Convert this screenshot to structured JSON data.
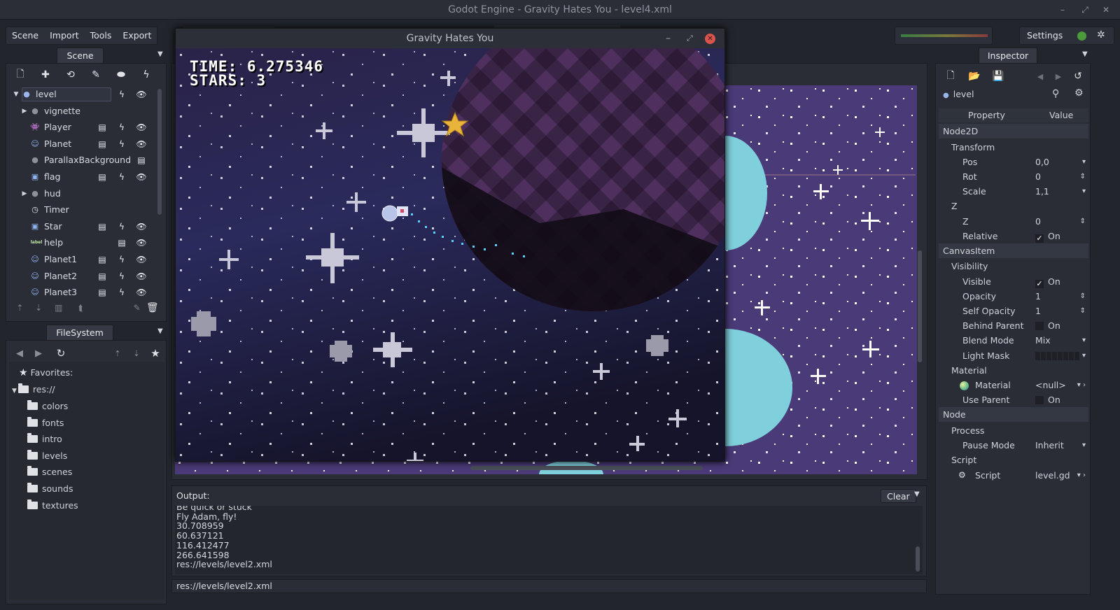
{
  "window": {
    "title": "Godot Engine - Gravity Hates You - level4.xml"
  },
  "menu": [
    "Scene",
    "Import",
    "Tools",
    "Export"
  ],
  "top_right": {
    "settings": "Settings"
  },
  "scene_panel": {
    "tab": "Scene",
    "nodes": [
      {
        "label": "level",
        "icon": "node2d-icon",
        "icon_char": "●",
        "icon_color": "#9ab6e8",
        "arrow": "▼",
        "depth": 0,
        "selected": true,
        "buttons": [
          "script-icon",
          "visibility-icon"
        ]
      },
      {
        "label": "vignette",
        "icon": "node-icon",
        "icon_char": "●",
        "icon_color": "#8d9099",
        "arrow": "▶",
        "depth": 1,
        "buttons": []
      },
      {
        "label": "Player",
        "icon": "kinematic-body-icon",
        "icon_char": "👾",
        "icon_color": "#8fb3f0",
        "arrow": "",
        "depth": 1,
        "buttons": [
          "open-scene-icon",
          "script-icon",
          "visibility-icon"
        ]
      },
      {
        "label": "Planet",
        "icon": "rigid-body-icon",
        "icon_char": "☺",
        "icon_color": "#8fb3f0",
        "arrow": "",
        "depth": 1,
        "buttons": [
          "open-scene-icon",
          "script-icon",
          "visibility-icon"
        ]
      },
      {
        "label": "ParallaxBackground",
        "icon": "node-icon",
        "icon_char": "●",
        "icon_color": "#8d9099",
        "arrow": "",
        "depth": 1,
        "buttons": [
          "open-scene-icon"
        ]
      },
      {
        "label": "flag",
        "icon": "area-icon",
        "icon_char": "▣",
        "icon_color": "#8fb3f0",
        "arrow": "",
        "depth": 1,
        "buttons": [
          "open-scene-icon",
          "script-icon",
          "visibility-icon"
        ]
      },
      {
        "label": "hud",
        "icon": "node-icon",
        "icon_char": "●",
        "icon_color": "#8d9099",
        "arrow": "▶",
        "depth": 1,
        "buttons": []
      },
      {
        "label": "Timer",
        "icon": "timer-icon",
        "icon_char": "◷",
        "icon_color": "#e6e8ec",
        "arrow": "",
        "depth": 1,
        "buttons": []
      },
      {
        "label": "Star",
        "icon": "area-icon",
        "icon_char": "▣",
        "icon_color": "#8fb3f0",
        "arrow": "",
        "depth": 1,
        "buttons": [
          "open-scene-icon",
          "script-icon",
          "visibility-icon"
        ]
      },
      {
        "label": "help",
        "icon": "label-icon",
        "icon_char": "label",
        "icon_color": "#bfe9a8",
        "arrow": "",
        "depth": 1,
        "buttons": [
          "open-scene-icon",
          "visibility-icon"
        ]
      },
      {
        "label": "Planet1",
        "icon": "rigid-body-icon",
        "icon_char": "☺",
        "icon_color": "#8fb3f0",
        "arrow": "",
        "depth": 1,
        "buttons": [
          "open-scene-icon",
          "script-icon",
          "visibility-icon"
        ]
      },
      {
        "label": "Planet2",
        "icon": "rigid-body-icon",
        "icon_char": "☺",
        "icon_color": "#8fb3f0",
        "arrow": "",
        "depth": 1,
        "buttons": [
          "open-scene-icon",
          "script-icon",
          "visibility-icon"
        ]
      },
      {
        "label": "Planet3",
        "icon": "rigid-body-icon",
        "icon_char": "☺",
        "icon_color": "#8fb3f0",
        "arrow": "",
        "depth": 1,
        "buttons": [
          "open-scene-icon",
          "script-icon",
          "visibility-icon"
        ]
      }
    ]
  },
  "filesystem": {
    "tab": "FileSystem",
    "favorites": "Favorites:",
    "root": "res://",
    "folders": [
      "colors",
      "fonts",
      "intro",
      "levels",
      "scenes",
      "sounds",
      "textures"
    ]
  },
  "game": {
    "title": "Gravity Hates You",
    "time_text": "TIME: 6.275346",
    "stars_text": "STARS: 3"
  },
  "inspector": {
    "tab": "Inspector",
    "node": "level",
    "col_property": "Property",
    "col_value": "Value",
    "rows": [
      {
        "kind": "section",
        "label": "Node2D"
      },
      {
        "kind": "group",
        "label": "Transform"
      },
      {
        "kind": "prop",
        "label": "Pos",
        "value": "0,0",
        "spin": "▾"
      },
      {
        "kind": "prop",
        "label": "Rot",
        "value": "0",
        "spin": "⇕"
      },
      {
        "kind": "prop",
        "label": "Scale",
        "value": "1,1",
        "spin": "▾"
      },
      {
        "kind": "group",
        "label": "Z"
      },
      {
        "kind": "prop",
        "label": "Z",
        "value": "0",
        "spin": "⇕"
      },
      {
        "kind": "check",
        "label": "Relative",
        "value": "On",
        "checked": true
      },
      {
        "kind": "section",
        "label": "CanvasItem"
      },
      {
        "kind": "group",
        "label": "Visibility"
      },
      {
        "kind": "check",
        "label": "Visible",
        "value": "On",
        "checked": true
      },
      {
        "kind": "prop",
        "label": "Opacity",
        "value": "1",
        "spin": "⇕"
      },
      {
        "kind": "prop",
        "label": "Self Opacity",
        "value": "1",
        "spin": "⇕"
      },
      {
        "kind": "check",
        "label": "Behind Parent",
        "value": "On",
        "checked": false
      },
      {
        "kind": "prop",
        "label": "Blend Mode",
        "value": "Mix",
        "spin": "▾"
      },
      {
        "kind": "mask",
        "label": "Light Mask",
        "value": "",
        "spin": "▾"
      },
      {
        "kind": "group",
        "label": "Material"
      },
      {
        "kind": "prop",
        "label": "Material",
        "value": "<null>",
        "spin": "▾ ›",
        "icon": "material-icon"
      },
      {
        "kind": "check",
        "label": "Use Parent",
        "value": "On",
        "checked": false
      },
      {
        "kind": "section",
        "label": "Node"
      },
      {
        "kind": "group",
        "label": "Process"
      },
      {
        "kind": "prop",
        "label": "Pause Mode",
        "value": "Inherit",
        "spin": "▾"
      },
      {
        "kind": "group",
        "label": "Script"
      },
      {
        "kind": "prop",
        "label": "Script",
        "value": "level.gd",
        "spin": "▾ ›",
        "icon": "gear-icon"
      }
    ]
  },
  "output": {
    "label": "Output:",
    "clear": "Clear",
    "lines": [
      "Be quick or stuck",
      "Fly Adam, fly!",
      "30.708959",
      "60.637121",
      "116.412477",
      "266.641598",
      "res://levels/level2.xml"
    ],
    "status": "res://levels/level2.xml"
  },
  "colors": {
    "accent": "#9ab6e8",
    "close": "#d9534f",
    "planet_cyan": "#7fcfdc",
    "space_purple": "#4a3a78"
  }
}
